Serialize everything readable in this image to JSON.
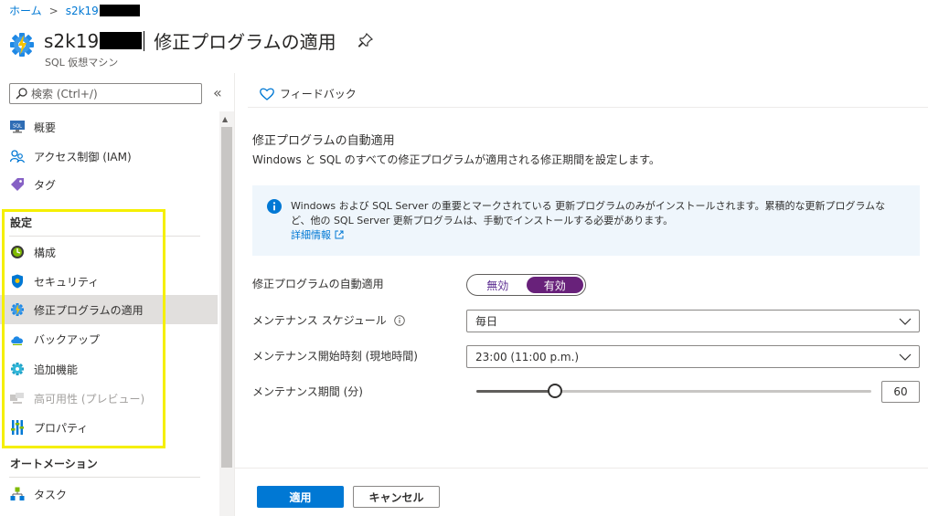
{
  "breadcrumb": {
    "home": "ホーム",
    "separator": ">",
    "resource": "s2k19"
  },
  "header": {
    "title_prefix": "s2k19",
    "title_suffix": "修正プログラムの適用",
    "subtitle": "SQL 仮想マシン",
    "icon": "gear-icon",
    "pin_icon": "pin-icon"
  },
  "sidebar": {
    "search_placeholder": "検索 (Ctrl+/)",
    "collapse_label": "«",
    "top_items": [
      {
        "label": "概要",
        "icon": "sql-overview-icon"
      },
      {
        "label": "アクセス制御 (IAM)",
        "icon": "people-icon"
      },
      {
        "label": "タグ",
        "icon": "tag-icon"
      }
    ],
    "settings_header": "設定",
    "settings_items": [
      {
        "label": "構成",
        "icon": "config-icon"
      },
      {
        "label": "セキュリティ",
        "icon": "shield-icon"
      },
      {
        "label": "修正プログラムの適用",
        "icon": "gear-icon",
        "selected": true
      },
      {
        "label": "バックアップ",
        "icon": "cloud-backup-icon"
      },
      {
        "label": "追加機能",
        "icon": "gear-addon-icon"
      },
      {
        "label": "高可用性 (プレビュー)",
        "icon": "high-availability-icon",
        "disabled": true
      },
      {
        "label": "プロパティ",
        "icon": "properties-icon"
      }
    ],
    "automation_header": "オートメーション",
    "automation_items": [
      {
        "label": "タスク",
        "icon": "tasks-icon"
      }
    ]
  },
  "content": {
    "feedback_label": "フィードバック",
    "section_title": "修正プログラムの自動適用",
    "section_desc": "Windows と SQL のすべての修正プログラムが適用される修正期間を設定します。",
    "info": {
      "text": "Windows および SQL Server の重要とマークされている 更新プログラムのみがインストールされます。累積的な更新プログラムなど、他の SQL Server 更新プログラムは、手動でインストールする必要があります。",
      "link": "詳細情報"
    },
    "form": {
      "auto_patch_label": "修正プログラムの自動適用",
      "toggle_off": "無効",
      "toggle_on": "有効",
      "toggle_value": "有効",
      "schedule_label": "メンテナンス スケジュール",
      "schedule_value": "毎日",
      "start_label": "メンテナンス開始時刻 (現地時間)",
      "start_value": "23:00 (11:00 p.m.)",
      "duration_label": "メンテナンス期間 (分)",
      "duration_value": "60",
      "duration_fraction": 0.2
    }
  },
  "footer": {
    "apply_label": "適用",
    "cancel_label": "キャンセル"
  },
  "colors": {
    "accent": "#0078d4",
    "toggle_on": "#68217a",
    "highlight": "#f5ef00"
  }
}
